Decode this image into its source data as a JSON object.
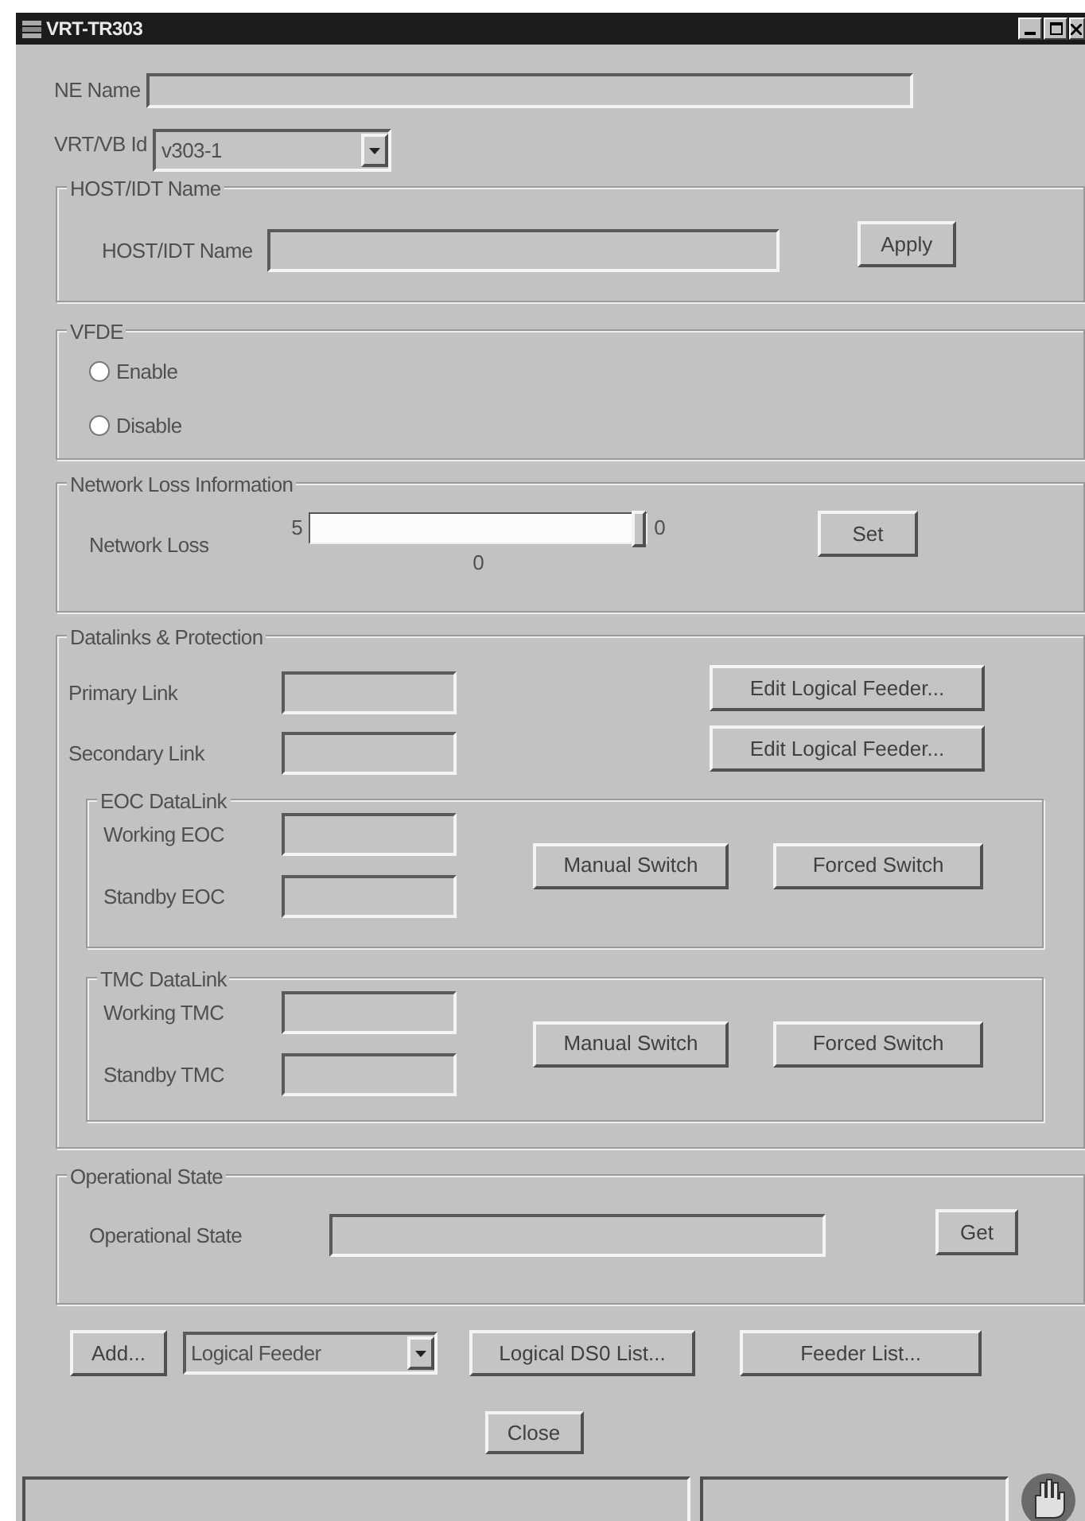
{
  "window": {
    "title": "VRT-TR303"
  },
  "ne_name": {
    "label": "NE Name"
  },
  "vrt_vb_id": {
    "label": "VRT/VB Id",
    "value": "v303-1"
  },
  "host_idt": {
    "title": "HOST/IDT Name",
    "label": "HOST/IDT Name",
    "button": "Apply"
  },
  "vfde": {
    "title": "VFDE",
    "options": [
      {
        "label": "Enable",
        "selected": false
      },
      {
        "label": "Disable",
        "selected": false
      }
    ]
  },
  "network_loss": {
    "title": "Network Loss Information",
    "label": "Network Loss",
    "min_label": "5",
    "max_label": "0",
    "level": 1,
    "reading": "0",
    "button": "Set"
  },
  "datalinks": {
    "title": "Datalinks & Protection",
    "links": [
      {
        "label": "Primary Link",
        "button": "Edit Logical Feeder..."
      },
      {
        "label": "Secondary Link",
        "button": "Edit Logical Feeder..."
      }
    ],
    "groups": [
      {
        "title": "EOC DataLink",
        "fields": [
          "Working EOC",
          "Standby EOC"
        ],
        "buttons": [
          "Manual Switch",
          "Forced Switch"
        ]
      },
      {
        "title": "TMC DataLink",
        "fields": [
          "Working TMC",
          "Standby TMC"
        ],
        "buttons": [
          "Manual Switch",
          "Forced Switch"
        ]
      }
    ]
  },
  "operational_state": {
    "title": "Operational State",
    "label": "Operational State",
    "button": "Get"
  },
  "bottom_bar": {
    "add_button": "Add...",
    "type_select": "Logical Feeder",
    "buttons": [
      "Logical DS0 List...",
      "Feeder List..."
    ]
  },
  "close_button": "Close"
}
